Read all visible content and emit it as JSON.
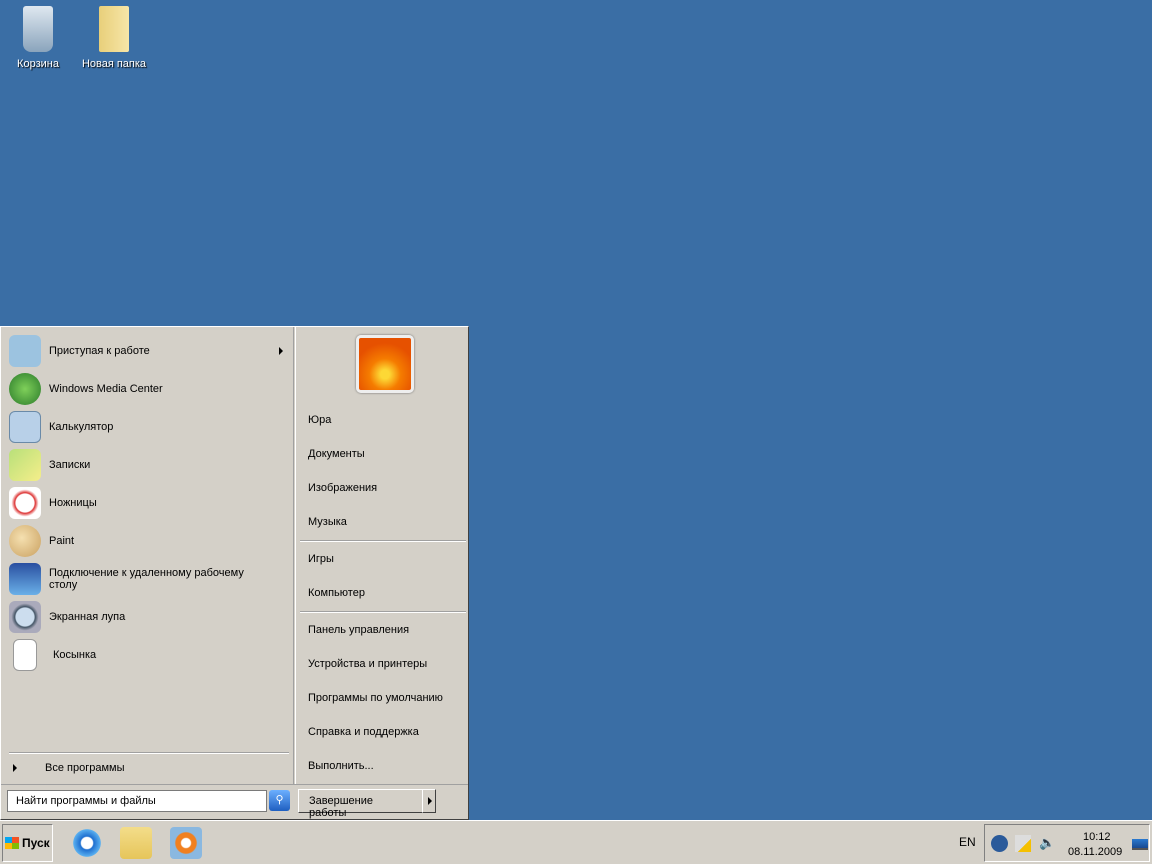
{
  "desktop": {
    "icons": [
      {
        "label": "Корзина",
        "icon": "recycle-bin-icon"
      },
      {
        "label": "Новая папка",
        "icon": "folder-icon"
      }
    ]
  },
  "start_menu": {
    "programs": [
      {
        "label": "Приступая к работе",
        "has_submenu": true
      },
      {
        "label": "Windows Media Center"
      },
      {
        "label": "Калькулятор"
      },
      {
        "label": "Записки"
      },
      {
        "label": "Ножницы"
      },
      {
        "label": "Paint"
      },
      {
        "label": "Подключение к удаленному рабочему столу"
      },
      {
        "label": "Экранная лупа"
      },
      {
        "label": "Косынка"
      }
    ],
    "all_programs": "Все программы",
    "search_placeholder": "Найти программы и файлы",
    "places": [
      "Юра",
      "Документы",
      "Изображения",
      "Музыка",
      "Игры",
      "Компьютер",
      "Панель управления",
      "Устройства и принтеры",
      "Программы по умолчанию",
      "Справка и поддержка",
      "Выполнить..."
    ],
    "shutdown": "Завершение работы"
  },
  "taskbar": {
    "start": "Пуск",
    "lang": "EN",
    "time": "10:12",
    "date": "08.11.2009"
  }
}
